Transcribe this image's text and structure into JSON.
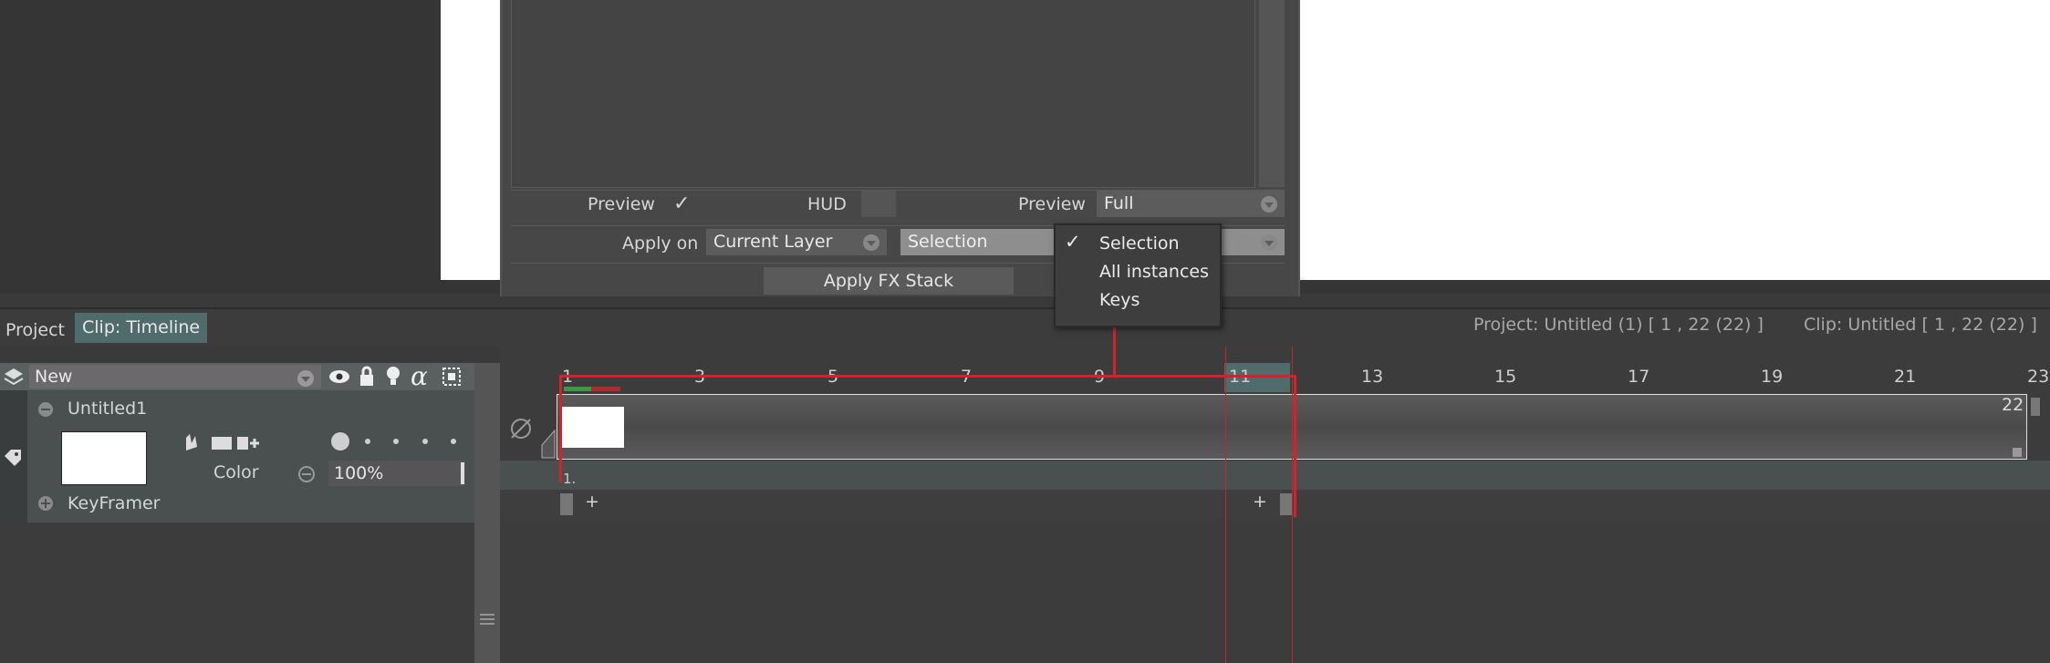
{
  "fx_panel": {
    "preview_label": "Preview",
    "preview_check": "✓",
    "hud_label": "HUD",
    "preview2_label": "Preview",
    "preview_value": "Full",
    "apply_on_label": "Apply on",
    "apply_on_value": "Current Layer",
    "scope_value": "Selection",
    "apply_button": "Apply FX Stack"
  },
  "popup": {
    "items": [
      "Selection",
      "All instances",
      "Keys"
    ],
    "checked_mark": "✓"
  },
  "timeline": {
    "tab_project": "Project",
    "tab_clip": "Clip: Timeline",
    "project_info": "Project: Untitled (1) [ 1 , 22  (22) ]",
    "clip_info": "Clip: Untitled [ 1 , 22  (22) ]",
    "ruler_ticks": [
      "1",
      "3",
      "5",
      "7",
      "9",
      "11",
      "13",
      "15",
      "17",
      "19",
      "21",
      "23"
    ],
    "end_frame": "22",
    "key_label": "1.",
    "plus": "+"
  },
  "layers": {
    "new_label": "New",
    "layer_name": "Untitled1",
    "color_label": "Color",
    "opacity": "100%",
    "keyframer_label": "KeyFramer"
  }
}
